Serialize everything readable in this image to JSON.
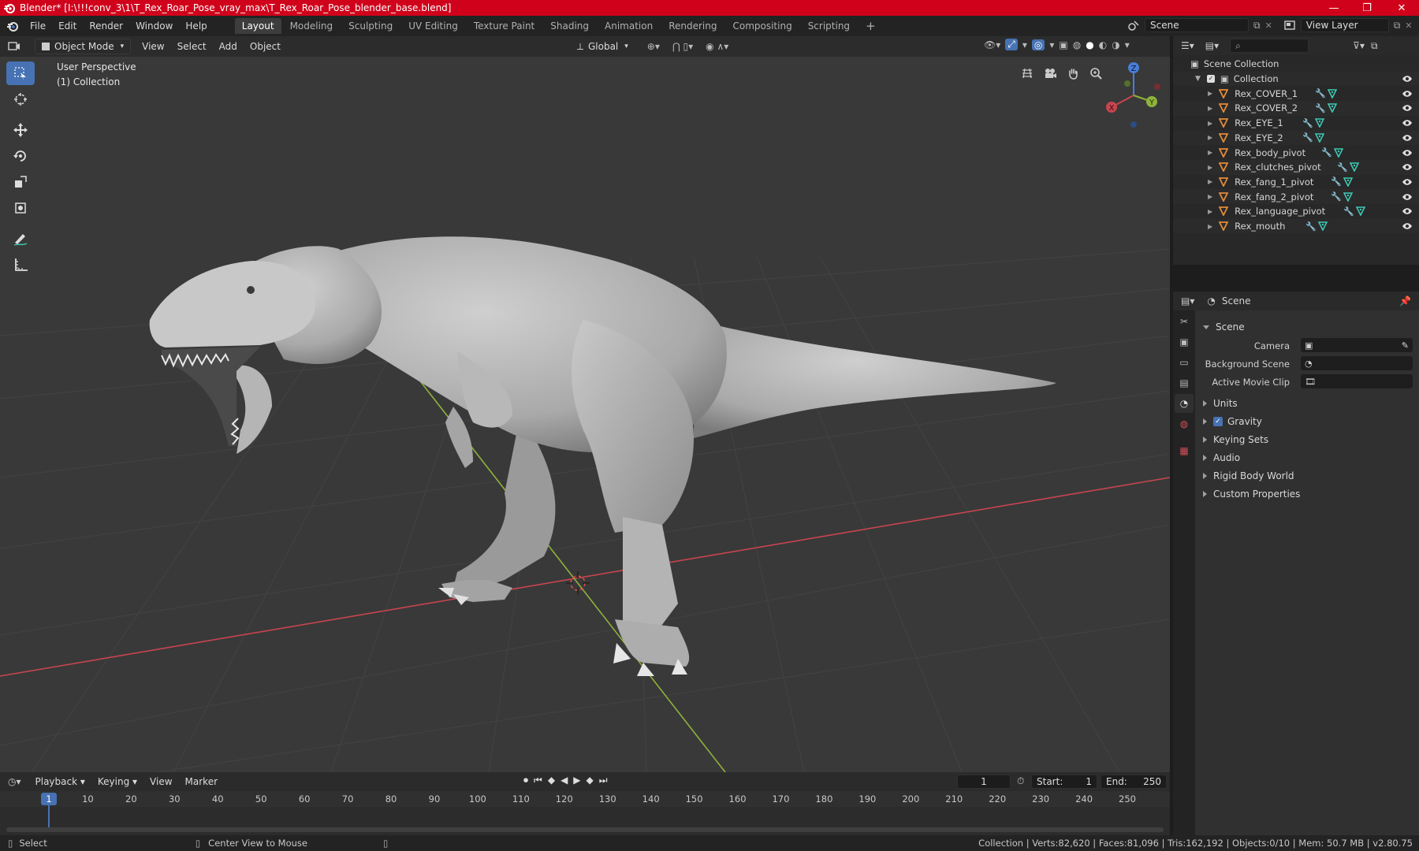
{
  "window": {
    "title": "Blender* [I:\\!!!conv_3\\1\\T_Rex_Roar_Pose_vray_max\\T_Rex_Roar_Pose_blender_base.blend]",
    "minimize": "—",
    "maximize": "❐",
    "close": "✕"
  },
  "menu": [
    "File",
    "Edit",
    "Render",
    "Window",
    "Help"
  ],
  "workspaces": [
    "Layout",
    "Modeling",
    "Sculpting",
    "UV Editing",
    "Texture Paint",
    "Shading",
    "Animation",
    "Rendering",
    "Compositing",
    "Scripting"
  ],
  "active_workspace": "Layout",
  "add_workspace": "+",
  "scene_selector": "Scene",
  "view_layer": "View Layer",
  "viewport": {
    "mode": "Object Mode",
    "menus": [
      "View",
      "Select",
      "Add",
      "Object"
    ],
    "transform_orientation": "Global",
    "info_line1": "User Perspective",
    "info_line2": "(1) Collection",
    "gizmo": {
      "x": "X",
      "y": "Y",
      "z": "Z"
    }
  },
  "outliner": {
    "root": "Scene Collection",
    "collection": "Collection",
    "objects": [
      "Rex_COVER_1",
      "Rex_COVER_2",
      "Rex_EYE_1",
      "Rex_EYE_2",
      "Rex_body_pivot",
      "Rex_clutches_pivot",
      "Rex_fang_1_pivot",
      "Rex_fang_2_pivot",
      "Rex_language_pivot",
      "Rex_mouth"
    ]
  },
  "properties": {
    "context": "Scene",
    "panel_title": "Scene",
    "camera_label": "Camera",
    "background_scene_label": "Background Scene",
    "active_movie_clip_label": "Active Movie Clip",
    "sections": [
      "Units",
      "Gravity",
      "Keying Sets",
      "Audio",
      "Rigid Body World",
      "Custom Properties"
    ],
    "gravity_checked": true
  },
  "timeline": {
    "menus": [
      "Playback",
      "Keying",
      "View",
      "Marker"
    ],
    "current_frame": "1",
    "start_label": "Start:",
    "start": "1",
    "end_label": "End:",
    "end": "250",
    "ticks": [
      "1",
      "10",
      "20",
      "30",
      "40",
      "50",
      "60",
      "70",
      "80",
      "90",
      "100",
      "110",
      "120",
      "130",
      "140",
      "150",
      "160",
      "170",
      "180",
      "190",
      "200",
      "210",
      "220",
      "230",
      "240",
      "250"
    ]
  },
  "status": {
    "left_action": "Select",
    "middle_action": "Center View to Mouse",
    "stats": "Collection | Verts:82,620 | Faces:81,096 | Tris:162,192 | Objects:0/10 | Mem: 50.7 MB | v2.80.75"
  },
  "colors": {
    "titlebar": "#d0021b",
    "accent": "#4772b3",
    "viewport_bg": "#393939",
    "x_axis": "#c8454f",
    "y_axis": "#8fb33a",
    "z_axis": "#4a7ed8",
    "object_icon": "#e38b3a",
    "modifier_icon": "#6fa7e8",
    "mesh_icon": "#3ec9b4"
  }
}
